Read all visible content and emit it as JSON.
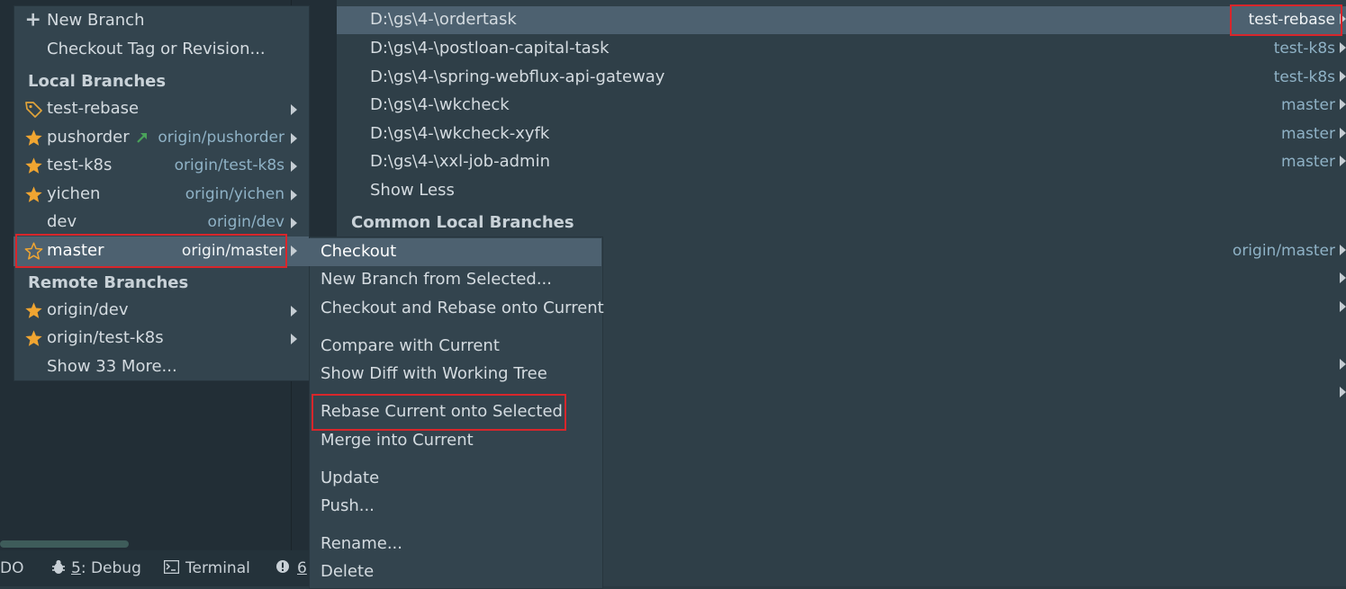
{
  "repositories": [
    {
      "path": "D:\\gs\\4-\\ordertask",
      "branch": "test-rebase",
      "selected": true
    },
    {
      "path": "D:\\gs\\4-\\postloan-capital-task",
      "branch": "test-k8s"
    },
    {
      "path": "D:\\gs\\4-\\spring-webflux-api-gateway",
      "branch": "test-k8s"
    },
    {
      "path": "D:\\gs\\4-\\wkcheck",
      "branch": "master"
    },
    {
      "path": "D:\\gs\\4-\\wkcheck-xyfk",
      "branch": "master"
    },
    {
      "path": "D:\\gs\\4-\\xxl-job-admin",
      "branch": "master"
    }
  ],
  "show_less": "Show Less",
  "common_local_branches": "Common Local Branches",
  "common_row_tracking": "origin/master",
  "branch_popup": {
    "new_branch": "New Branch",
    "checkout_tag": "Checkout Tag or Revision...",
    "local_header": "Local Branches",
    "local": [
      {
        "name": "test-rebase",
        "tracking": "",
        "icon": "tag-icon"
      },
      {
        "name": "pushorder",
        "tracking": "origin/pushorder",
        "icon": "star-filled-icon"
      },
      {
        "name": "test-k8s",
        "tracking": "origin/test-k8s",
        "icon": "star-filled-icon"
      },
      {
        "name": "yichen",
        "tracking": "origin/yichen",
        "icon": "star-filled-icon"
      },
      {
        "name": "dev",
        "tracking": "origin/dev",
        "icon": ""
      },
      {
        "name": "master",
        "tracking": "origin/master",
        "icon": "star-outline-icon"
      }
    ],
    "remote_header": "Remote Branches",
    "remote": [
      {
        "name": "origin/dev",
        "icon": "star-filled-icon"
      },
      {
        "name": "origin/test-k8s",
        "icon": "star-filled-icon"
      }
    ],
    "show_more": "Show 33 More..."
  },
  "context_menu": {
    "items": [
      "Checkout",
      "New Branch from Selected...",
      "Checkout and Rebase onto Current",
      "Compare with Current",
      "Show Diff with Working Tree",
      "Rebase Current onto Selected",
      "Merge into Current",
      "Update",
      "Push...",
      "Rename...",
      "Delete"
    ]
  },
  "status_bar": {
    "todo": "DO",
    "debug_num": "5",
    "debug_label": ": Debug",
    "terminal": "Terminal",
    "problems_num": "6"
  },
  "colors": {
    "highlight": "#d8262b",
    "star": "#f0a531",
    "selection": "#4d6170",
    "link": "#8fb2c6",
    "outgoing_arrow": "#4aa35a"
  }
}
